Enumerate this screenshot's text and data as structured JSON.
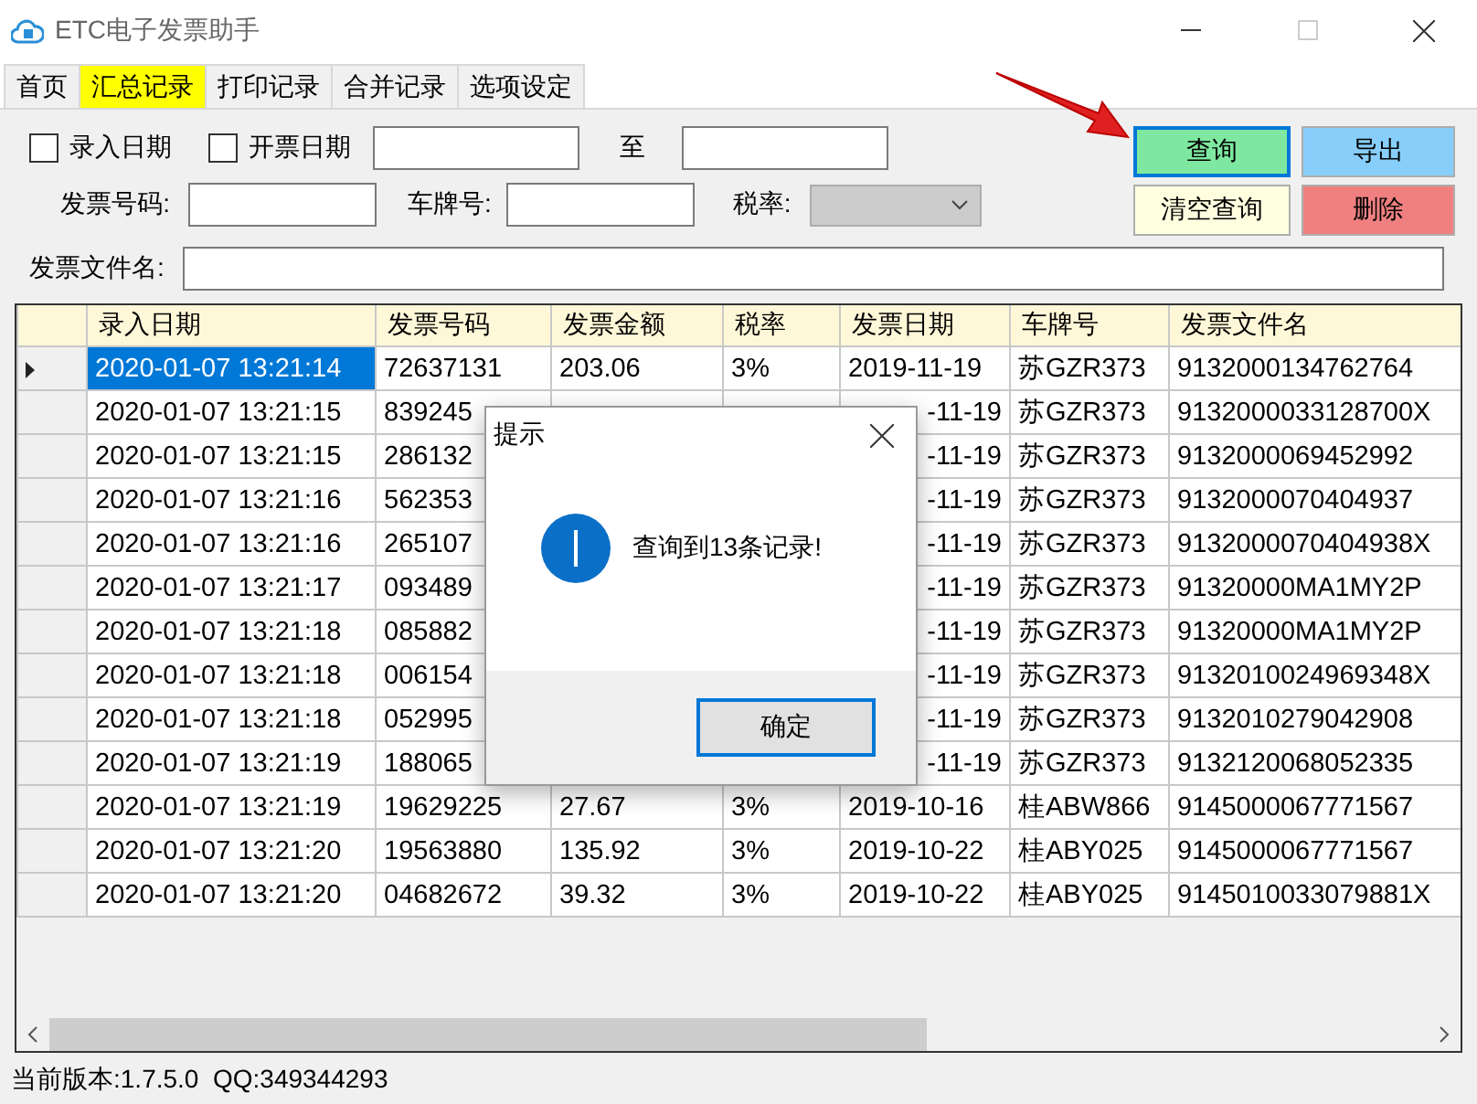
{
  "window": {
    "title": "ETC电子发票助手"
  },
  "tabs": [
    {
      "label": "首页",
      "selected": false
    },
    {
      "label": "汇总记录",
      "selected": true
    },
    {
      "label": "打印记录",
      "selected": false
    },
    {
      "label": "合并记录",
      "selected": false
    },
    {
      "label": "选项设定",
      "selected": false
    }
  ],
  "filters": {
    "checks": [
      {
        "label": "录入日期",
        "checked": false
      },
      {
        "label": "开票日期",
        "checked": false
      }
    ],
    "to_label": "至",
    "invoice_no_label": "发票号码:",
    "plate_label": "车牌号:",
    "tax_rate_label": "税率:",
    "tax_rate_disabled": true,
    "file_name_label": "发票文件名:"
  },
  "buttons": [
    {
      "label": "查询",
      "color": "#7ee8a0",
      "focused": true
    },
    {
      "label": "导出",
      "color": "#87cefa",
      "focused": false
    },
    {
      "label": "清空查询",
      "color": "#ffffe0",
      "focused": false
    },
    {
      "label": "删除",
      "color": "#f08080",
      "focused": false
    }
  ],
  "table": {
    "columns": [
      "录入日期",
      "发票号码",
      "发票金额",
      "税率",
      "发票日期",
      "车牌号",
      "发票文件名"
    ],
    "rows": [
      {
        "selected": true,
        "covered": false,
        "entry_date": "2020-01-07 13:21:14",
        "invoice_no": "72637131",
        "amount": "203.06",
        "tax_rate": "3%",
        "invoice_date": "2019-11-19",
        "plate": "苏GZR373",
        "file_name": "9132000134762764"
      },
      {
        "selected": false,
        "covered": true,
        "entry_date": "2020-01-07 13:21:15",
        "invoice_no": "839245",
        "invoice_date": "-11-19",
        "plate": "苏GZR373",
        "file_name": "9132000033128700X"
      },
      {
        "selected": false,
        "covered": true,
        "entry_date": "2020-01-07 13:21:15",
        "invoice_no": "286132",
        "invoice_date": "-11-19",
        "plate": "苏GZR373",
        "file_name": "9132000069452992"
      },
      {
        "selected": false,
        "covered": true,
        "entry_date": "2020-01-07 13:21:16",
        "invoice_no": "562353",
        "invoice_date": "-11-19",
        "plate": "苏GZR373",
        "file_name": "9132000070404937"
      },
      {
        "selected": false,
        "covered": true,
        "entry_date": "2020-01-07 13:21:16",
        "invoice_no": "265107",
        "invoice_date": "-11-19",
        "plate": "苏GZR373",
        "file_name": "9132000070404938X"
      },
      {
        "selected": false,
        "covered": true,
        "entry_date": "2020-01-07 13:21:17",
        "invoice_no": "093489",
        "invoice_date": "-11-19",
        "plate": "苏GZR373",
        "file_name": "91320000MA1MY2P"
      },
      {
        "selected": false,
        "covered": true,
        "entry_date": "2020-01-07 13:21:18",
        "invoice_no": "085882",
        "invoice_date": "-11-19",
        "plate": "苏GZR373",
        "file_name": "91320000MA1MY2P"
      },
      {
        "selected": false,
        "covered": true,
        "entry_date": "2020-01-07 13:21:18",
        "invoice_no": "006154",
        "invoice_date": "-11-19",
        "plate": "苏GZR373",
        "file_name": "9132010024969348X"
      },
      {
        "selected": false,
        "covered": true,
        "entry_date": "2020-01-07 13:21:18",
        "invoice_no": "052995",
        "invoice_date": "-11-19",
        "plate": "苏GZR373",
        "file_name": "9132010279042908"
      },
      {
        "selected": false,
        "covered": true,
        "entry_date": "2020-01-07 13:21:19",
        "invoice_no": "188065",
        "invoice_date": "-11-19",
        "plate": "苏GZR373",
        "file_name": "9132120068052335"
      },
      {
        "selected": false,
        "covered": false,
        "entry_date": "2020-01-07 13:21:19",
        "invoice_no": "19629225",
        "amount": "27.67",
        "tax_rate": "3%",
        "invoice_date": "2019-10-16",
        "plate": "桂ABW866",
        "file_name": "9145000067771567"
      },
      {
        "selected": false,
        "covered": false,
        "entry_date": "2020-01-07 13:21:20",
        "invoice_no": "19563880",
        "amount": "135.92",
        "tax_rate": "3%",
        "invoice_date": "2019-10-22",
        "plate": "桂ABY025",
        "file_name": "9145000067771567"
      },
      {
        "selected": false,
        "covered": false,
        "entry_date": "2020-01-07 13:21:20",
        "invoice_no": "04682672",
        "amount": "39.32",
        "tax_rate": "3%",
        "invoice_date": "2019-10-22",
        "plate": "桂ABY025",
        "file_name": "9145010033079881X"
      }
    ]
  },
  "dialog": {
    "title": "提示",
    "message": "查询到13条记录!",
    "button": "确定"
  },
  "status_bar": "当前版本:1.7.5.0  QQ:349344293"
}
